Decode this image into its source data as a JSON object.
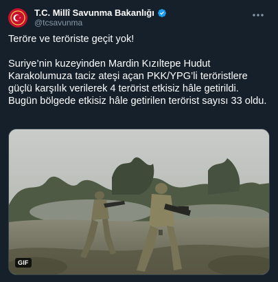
{
  "account": {
    "display_name": "T.C. Millî Savunma Bakanlığı",
    "handle": "@tcsavunma",
    "avatar_icon": "ministry-emblem-icon",
    "verified_icon": "verified-badge-icon",
    "more_icon": "more-options-icon"
  },
  "tweet": {
    "line1": "Teröre ve teröriste geçit yok!",
    "paragraph": "Suriye’nin kuzeyinden Mardin Kızıltepe Hudut Karakolumuza taciz ateşi açan PKK/YPG’li teröristlere güçlü karşılık verilerek 4 terörist etkisiz hâle getirildi. Bugün bölgede etkisiz hâle getirilen terörist sayısı 33 oldu."
  },
  "media": {
    "badge": "GIF",
    "description_icon": "soldiers-gif-thumbnail"
  },
  "colors": {
    "background": "#15202b",
    "text": "#ffffff",
    "muted": "#8899a6",
    "verified": "#1d9bf0",
    "avatar": "#c8102e"
  }
}
